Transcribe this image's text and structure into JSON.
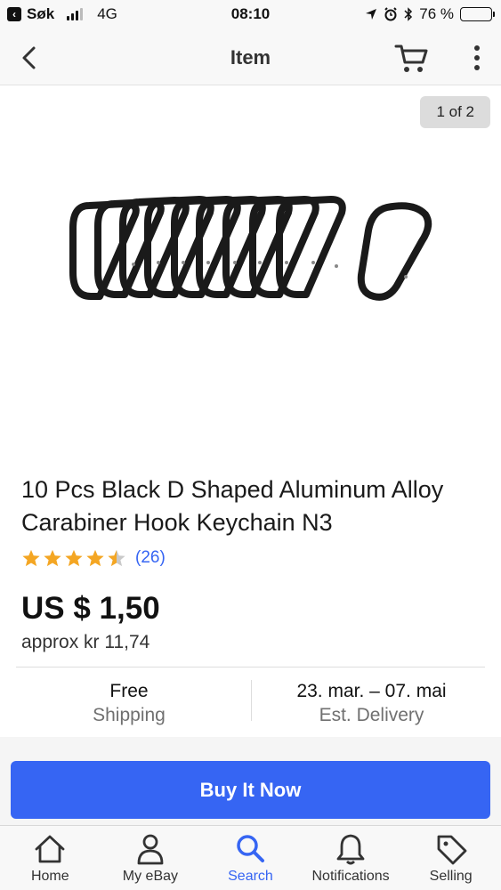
{
  "status_bar": {
    "carrier": "Søk",
    "network": "4G",
    "time": "08:10",
    "battery": "76 %",
    "battery_level": 0.76
  },
  "nav": {
    "title": "Item",
    "back_icon": "chevron-left-icon",
    "cart_icon": "cart-icon",
    "more_icon": "more-vertical-icon"
  },
  "gallery": {
    "page_indicator": "1 of 2"
  },
  "item": {
    "title": "10 Pcs Black D Shaped Aluminum Alloy Carabiner Hook Keychain N3",
    "rating_value": 4.5,
    "rating_count": "(26)",
    "price": "US $ 1,50",
    "approx_price": "approx kr 11,74"
  },
  "shipping": {
    "main": "Free",
    "sub": "Shipping"
  },
  "delivery": {
    "main": "23. mar. – 07. mai",
    "sub": "Est. Delivery"
  },
  "actions": {
    "buy_label": "Buy It Now"
  },
  "tabs": [
    {
      "label": "Home",
      "icon": "home-icon"
    },
    {
      "label": "My eBay",
      "icon": "user-icon"
    },
    {
      "label": "Search",
      "icon": "search-icon"
    },
    {
      "label": "Notifications",
      "icon": "bell-icon"
    },
    {
      "label": "Selling",
      "icon": "tag-icon"
    }
  ],
  "colors": {
    "accent": "#3665f3",
    "star": "#f4a623",
    "background": "#ffffff",
    "bar_background": "#f8f8f8"
  }
}
